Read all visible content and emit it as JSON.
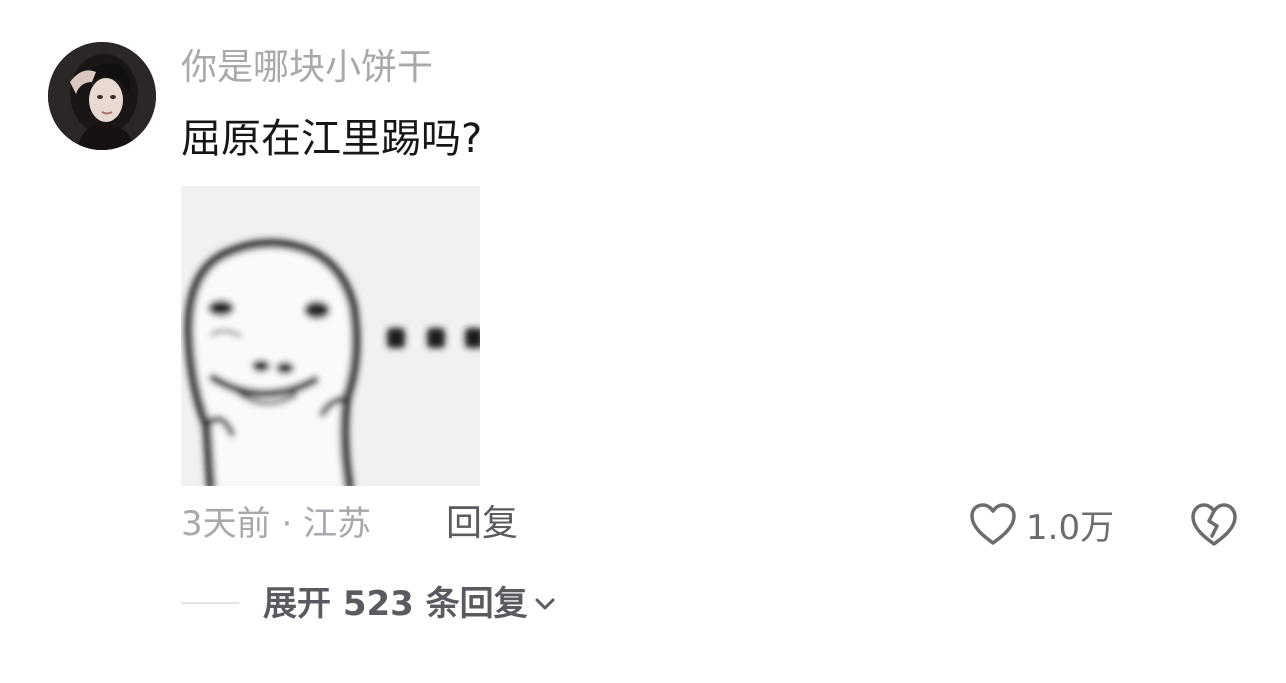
{
  "comment": {
    "username": "你是哪块小饼干",
    "text": "屈原在江里踢吗?",
    "sticker": "blurry-meme-face-ellipsis-icon",
    "time_location": "3天前 · 江苏",
    "reply_label": "回复",
    "like_count": "1.0万",
    "expand_replies_label": "展开 523 条回复"
  },
  "icons": {
    "like": "heart-outline-icon",
    "dislike": "broken-heart-icon",
    "expand": "chevron-down-icon"
  },
  "colors": {
    "username": "#a9a9ad",
    "text": "#161616",
    "meta": "#a9a9ad",
    "action": "#5a5a60"
  }
}
